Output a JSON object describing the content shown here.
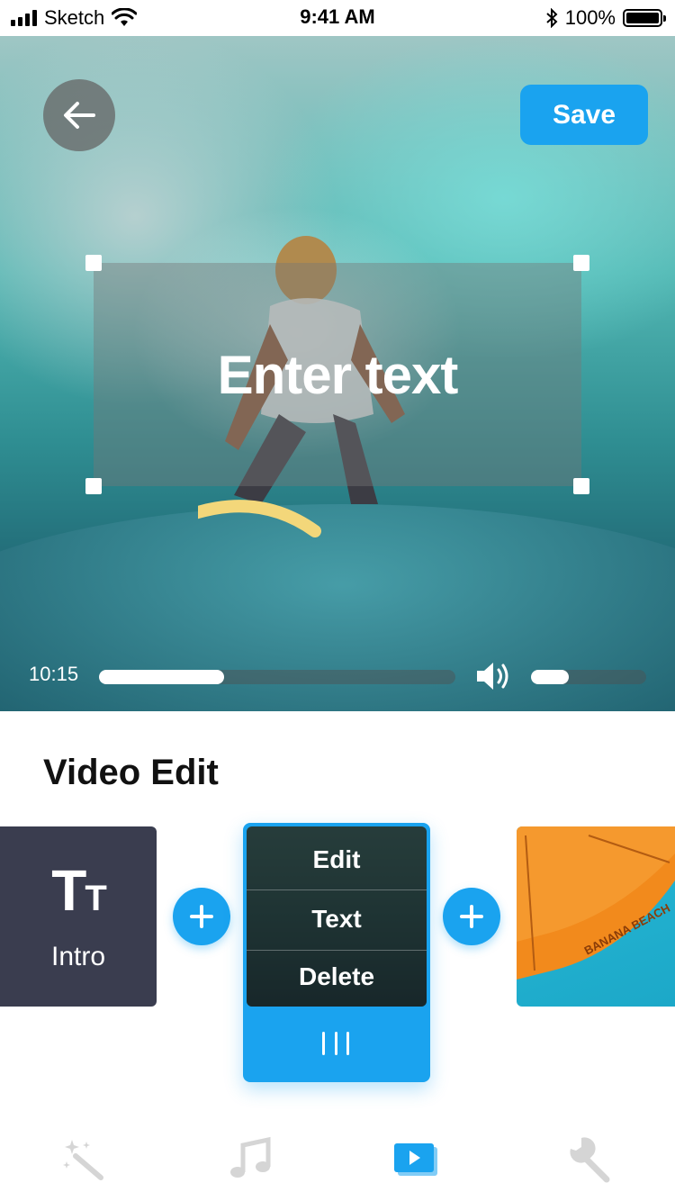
{
  "status_bar": {
    "carrier": "Sketch",
    "time": "9:41 AM",
    "battery_percent": "100%"
  },
  "video": {
    "save_label": "Save",
    "overlay_text": "Enter text",
    "current_time": "10:15",
    "progress_fraction": 0.35,
    "volume_fraction": 0.33
  },
  "section": {
    "title": "Video Edit"
  },
  "clips": {
    "intro": {
      "icon_text": "TT",
      "label": "Intro"
    },
    "selected": {
      "menu": [
        "Edit",
        "Text",
        "Delete"
      ]
    },
    "beach": {
      "image_text": "BANANA BEACH"
    }
  },
  "colors": {
    "accent": "#1aa3ef",
    "intro_bg": "#3a3d4f",
    "tab_inactive": "#d5d5d5"
  },
  "tabbar": {
    "items": [
      {
        "icon": "magic-wand-icon",
        "active": false
      },
      {
        "icon": "music-note-icon",
        "active": false
      },
      {
        "icon": "video-play-icon",
        "active": true
      },
      {
        "icon": "wrench-icon",
        "active": false
      }
    ]
  }
}
